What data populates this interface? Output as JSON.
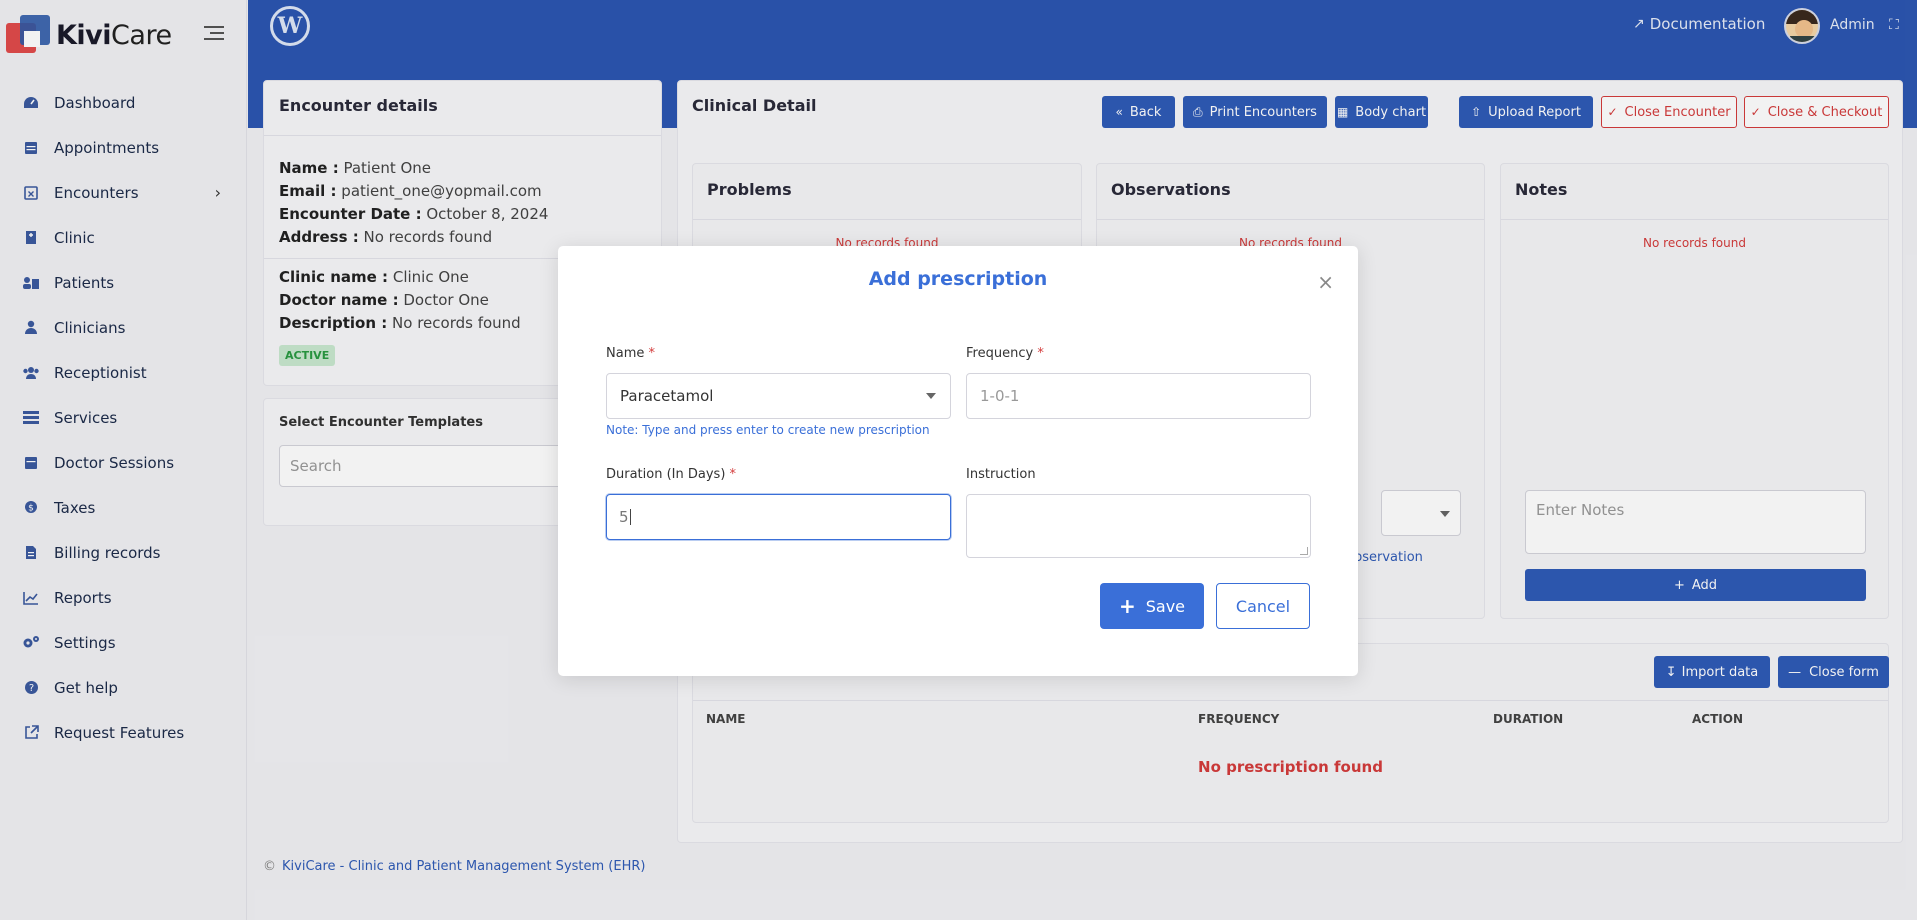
{
  "app": {
    "brand_bold": "Kivi",
    "brand_rest": "Care"
  },
  "sidebar": {
    "items": [
      {
        "label": "Dashboard",
        "icon": "dashboard-icon"
      },
      {
        "label": "Appointments",
        "icon": "calendar-icon"
      },
      {
        "label": "Encounters",
        "icon": "calendar-x-icon"
      },
      {
        "label": "Clinic",
        "icon": "hospital-icon"
      },
      {
        "label": "Patients",
        "icon": "patients-icon"
      },
      {
        "label": "Clinicians",
        "icon": "user-md-icon"
      },
      {
        "label": "Receptionist",
        "icon": "users-icon"
      },
      {
        "label": "Services",
        "icon": "list-icon"
      },
      {
        "label": "Doctor Sessions",
        "icon": "calendar-icon"
      },
      {
        "label": "Taxes",
        "icon": "money-icon"
      },
      {
        "label": "Billing records",
        "icon": "file-invoice-icon"
      },
      {
        "label": "Reports",
        "icon": "chart-line-icon"
      },
      {
        "label": "Settings",
        "icon": "gears-icon"
      },
      {
        "label": "Get help",
        "icon": "question-circle-icon"
      },
      {
        "label": "Request Features",
        "icon": "external-link-icon"
      }
    ]
  },
  "topbar": {
    "documentation": "Documentation",
    "admin": "Admin"
  },
  "encounter": {
    "title": "Encounter details",
    "name_label": "Name :",
    "name": "Patient One",
    "email_label": "Email :",
    "email": "patient_one@yopmail.com",
    "date_label": "Encounter Date :",
    "date": "October 8, 2024",
    "address_label": "Address :",
    "address": "No records found",
    "clinic_label": "Clinic name :",
    "clinic": "Clinic One",
    "doctor_label": "Doctor name :",
    "doctor": "Doctor One",
    "desc_label": "Description :",
    "desc": "No records found",
    "status": "ACTIVE"
  },
  "templates": {
    "label": "Select Encounter Templates",
    "placeholder": "Search"
  },
  "clinical": {
    "title": "Clinical Detail",
    "buttons": {
      "back": "Back",
      "print": "Print Encounters",
      "body_chart": "Body chart",
      "upload": "Upload Report",
      "close_encounter": "Close Encounter",
      "close_checkout": "Close & Checkout"
    },
    "problems": {
      "title": "Problems",
      "empty": "No records found"
    },
    "observations": {
      "title": "Observations",
      "empty": "No records found",
      "link_fragment": "observation"
    },
    "notes": {
      "title": "Notes",
      "empty": "No records found",
      "placeholder": "Enter Notes",
      "add": "Add"
    }
  },
  "prescription": {
    "import": "Import data",
    "close_form": "Close form",
    "columns": [
      "NAME",
      "FREQUENCY",
      "DURATION",
      "ACTION"
    ],
    "empty": "No prescription found"
  },
  "footer": {
    "text": "KiviCare - Clinic and Patient Management System (EHR)"
  },
  "modal": {
    "title": "Add prescription",
    "name_label": "Name",
    "name_value": "Paracetamol",
    "name_note": "Note: Type and press enter to create new prescription",
    "frequency_label": "Frequency",
    "frequency_placeholder": "1-0-1",
    "duration_label": "Duration (In Days)",
    "duration_value": "5",
    "instruction_label": "Instruction",
    "save": "Save",
    "cancel": "Cancel",
    "required_mark": "*"
  },
  "colors": {
    "primary": "#2c56b1",
    "accent": "#3a6fd8",
    "danger": "#d43c3c",
    "success": "#2a9a42"
  }
}
